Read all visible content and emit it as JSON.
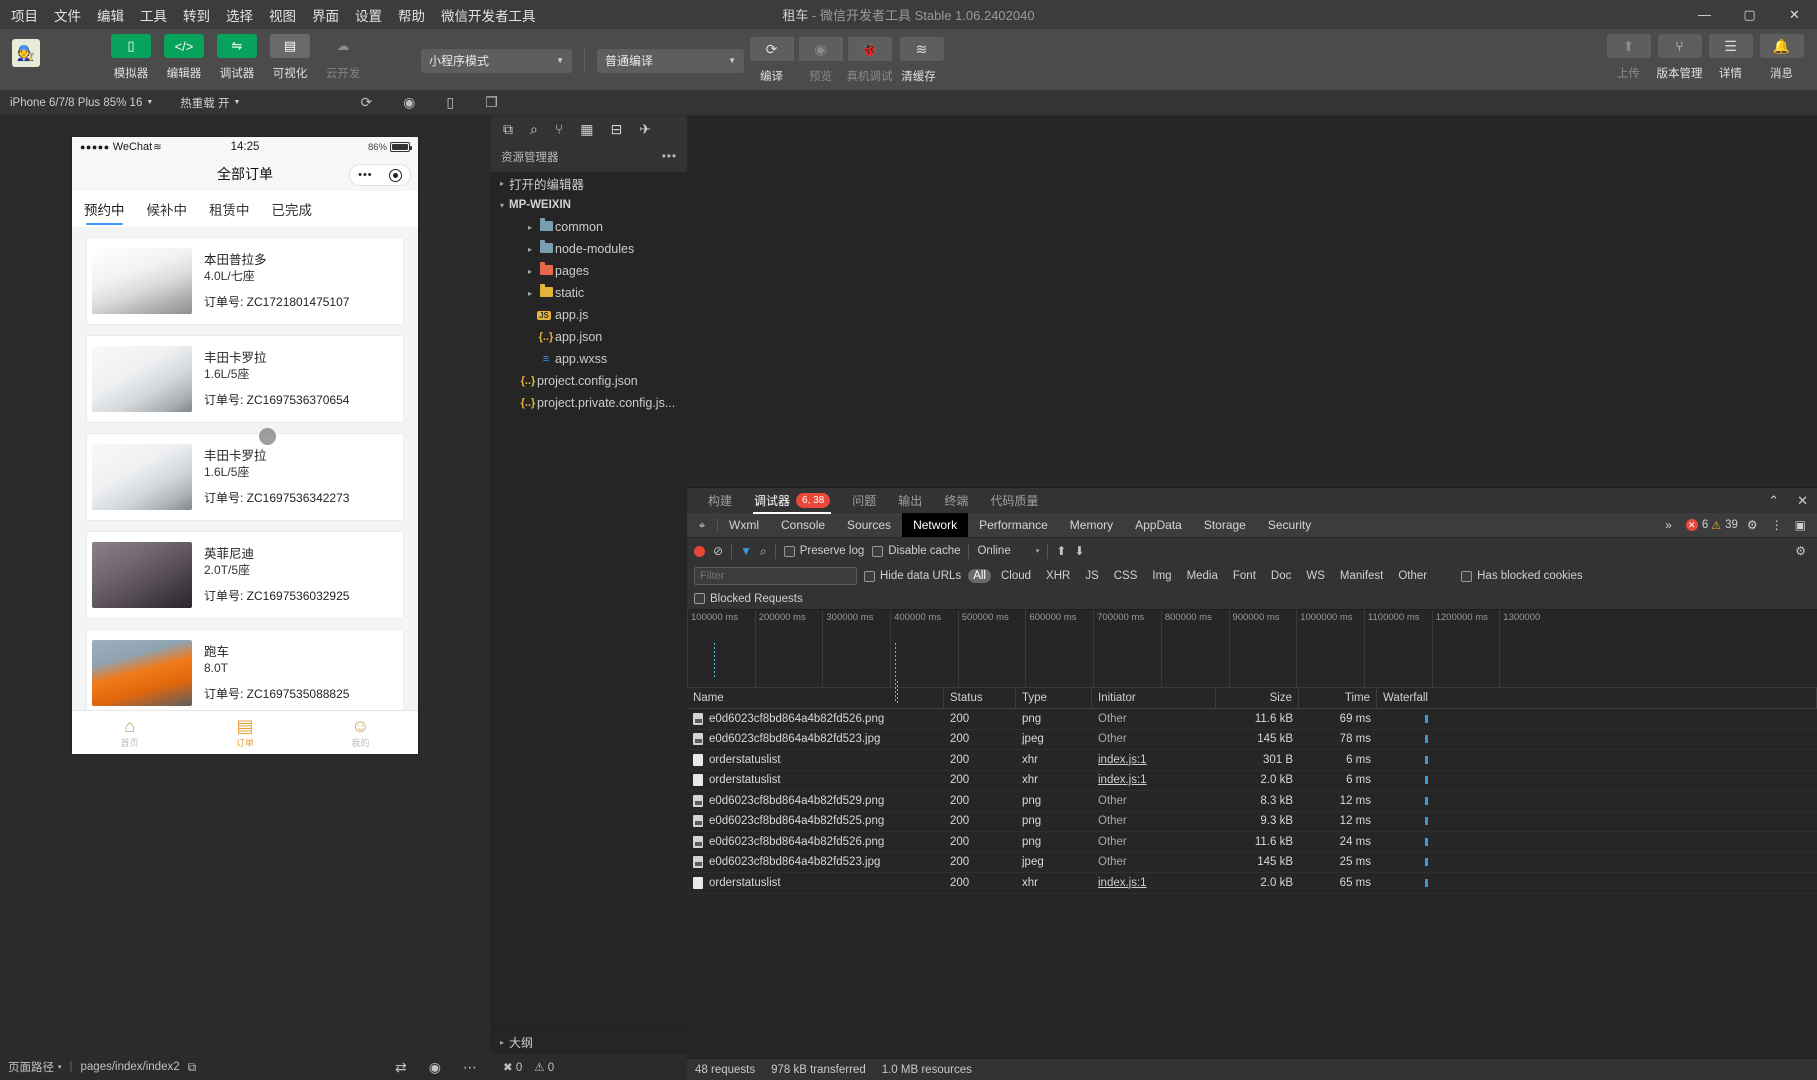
{
  "titlebar": {
    "menus": [
      "项目",
      "文件",
      "编辑",
      "工具",
      "转到",
      "选择",
      "视图",
      "界面",
      "设置",
      "帮助",
      "微信开发者工具"
    ],
    "title_main": "租车",
    "title_dim": " - 微信开发者工具 Stable 1.06.2402040",
    "minimize": "—",
    "maximize": "▢",
    "close": "✕"
  },
  "toolbar": {
    "avatar_icon": "user-avatar",
    "view_buttons": [
      {
        "label": "模拟器",
        "icon": "▯",
        "state": "green"
      },
      {
        "label": "编辑器",
        "icon": "</>",
        "state": "green"
      },
      {
        "label": "调试器",
        "icon": "⇋",
        "state": "green"
      },
      {
        "label": "可视化",
        "icon": "▤",
        "state": "gray"
      },
      {
        "label": "云开发",
        "icon": "☁",
        "state": "disabled"
      }
    ],
    "mode_select": "小程序模式",
    "compile_select": "普通编译",
    "action_buttons": [
      {
        "label": "编译",
        "icon": "⟳",
        "state": "normal"
      },
      {
        "label": "预览",
        "icon": "◉",
        "state": "disabled"
      },
      {
        "label": "真机调试",
        "icon": "🐞",
        "state": "disabled"
      },
      {
        "label": "清缓存",
        "icon": "≋",
        "state": "normal"
      }
    ],
    "right_buttons": [
      {
        "label": "上传",
        "icon": "⬆",
        "state": "disabled"
      },
      {
        "label": "版本管理",
        "icon": "⑂",
        "state": "normal"
      },
      {
        "label": "详情",
        "icon": "☰",
        "state": "normal"
      },
      {
        "label": "消息",
        "icon": "🔔",
        "state": "normal"
      }
    ]
  },
  "simbar": {
    "device": "iPhone 6/7/8 Plus 85% 16",
    "hotreload": "热重载 开",
    "icons": [
      "refresh-icon",
      "record-icon",
      "rotate-icon",
      "multi-window-icon"
    ]
  },
  "phone": {
    "status": {
      "dots": "●●●●●",
      "carrier": "WeChat",
      "wifi": "≋",
      "time": "14:25",
      "battery": "86%"
    },
    "nav_title": "全部订单",
    "capsule": {
      "dots": "•••",
      "circle": "◉"
    },
    "tabs": [
      {
        "label": "预约中",
        "active": true
      },
      {
        "label": "候补中",
        "active": false
      },
      {
        "label": "租赁中",
        "active": false
      },
      {
        "label": "已完成",
        "active": false
      }
    ],
    "order_label": "订单号:",
    "orders": [
      {
        "name": "本田普拉多",
        "spec": "4.0L/七座",
        "order_no": "ZC1721801475107",
        "car_kind": "white-suv"
      },
      {
        "name": "丰田卡罗拉",
        "spec": "1.6L/5座",
        "order_no": "ZC1697536370654",
        "car_kind": "white-sedan"
      },
      {
        "name": "丰田卡罗拉",
        "spec": "1.6L/5座",
        "order_no": "ZC1697536342273",
        "car_kind": "white-sedan"
      },
      {
        "name": "英菲尼迪",
        "spec": "2.0T/5座",
        "order_no": "ZC1697536032925",
        "car_kind": "dark-suv"
      },
      {
        "name": "跑车",
        "spec": "8.0T",
        "order_no": "ZC1697535088825",
        "car_kind": "orange-sport"
      }
    ],
    "tabbar": [
      {
        "label": "首页",
        "icon": "⌂",
        "active": false
      },
      {
        "label": "订单",
        "icon": "▤",
        "active": true
      },
      {
        "label": "我的",
        "icon": "☺",
        "active": false
      }
    ]
  },
  "pagepath": {
    "label": "页面路径",
    "caret": "▾",
    "path": "pages/index/index2",
    "copy_icon": "copy-icon",
    "right_icons": [
      "network-icon",
      "eye-icon",
      "more-icon"
    ]
  },
  "explorer": {
    "action_icons": [
      "files-icon",
      "search-icon",
      "source-control-icon",
      "extensions-icon",
      "debug-icon",
      "wechat-icon"
    ],
    "title": "资源管理器",
    "more": "•••",
    "tree": [
      {
        "label": "打开的编辑器",
        "level": 0,
        "arrow": "▸",
        "type": "section"
      },
      {
        "label": "MP-WEIXIN",
        "level": 0,
        "arrow": "▾",
        "type": "root"
      },
      {
        "label": "common",
        "level": 1,
        "arrow": "▸",
        "type": "folder",
        "color": "#7a9eb1"
      },
      {
        "label": "node-modules",
        "level": 1,
        "arrow": "▸",
        "type": "folder",
        "color": "#7a9eb1"
      },
      {
        "label": "pages",
        "level": 1,
        "arrow": "▸",
        "type": "folder",
        "color": "#e8684a"
      },
      {
        "label": "static",
        "level": 1,
        "arrow": "▸",
        "type": "folder",
        "color": "#e5b43a"
      },
      {
        "label": "app.js",
        "level": 1,
        "arrow": "",
        "type": "js",
        "icon": "JS",
        "color": "#e5b43a"
      },
      {
        "label": "app.json",
        "level": 1,
        "arrow": "",
        "type": "json",
        "icon": "{..}",
        "color": "#e5b43a"
      },
      {
        "label": "app.wxss",
        "level": 1,
        "arrow": "",
        "type": "css",
        "icon": "≡",
        "color": "#3b8ee0"
      },
      {
        "label": "project.config.json",
        "level": 0,
        "arrow": "",
        "type": "json",
        "icon": "{..}",
        "color": "#e5b43a"
      },
      {
        "label": "project.private.config.js...",
        "level": 0,
        "arrow": "",
        "type": "json",
        "icon": "{..}",
        "color": "#e5b43a"
      }
    ],
    "outline": {
      "label": "大纲",
      "arrow": "▸"
    },
    "status": {
      "errors": "0",
      "warnings": "0",
      "error_icon": "✖",
      "warn_icon": "⚠"
    }
  },
  "devtools": {
    "panel_tabs": [
      {
        "label": "构建",
        "active": false,
        "badge": ""
      },
      {
        "label": "调试器",
        "active": true,
        "badge": "6, 38"
      },
      {
        "label": "问题",
        "active": false,
        "badge": ""
      },
      {
        "label": "输出",
        "active": false,
        "badge": ""
      },
      {
        "label": "终端",
        "active": false,
        "badge": ""
      },
      {
        "label": "代码质量",
        "active": false,
        "badge": ""
      }
    ],
    "panel_controls": [
      "collapse-icon",
      "close-icon"
    ],
    "dev_tabs": [
      {
        "label": "Wxml",
        "selected": false
      },
      {
        "label": "Console",
        "selected": false
      },
      {
        "label": "Sources",
        "selected": false
      },
      {
        "label": "Network",
        "selected": true
      },
      {
        "label": "Performance",
        "selected": false
      },
      {
        "label": "Memory",
        "selected": false
      },
      {
        "label": "AppData",
        "selected": false
      },
      {
        "label": "Storage",
        "selected": false
      },
      {
        "label": "Security",
        "selected": false
      }
    ],
    "dev_overflow": "»",
    "error_count": "6",
    "warning_count": "39",
    "settings_icon": "⚙",
    "more_icon": "⋮",
    "dock_icon": "▣",
    "network": {
      "record_icon": "record-icon",
      "clear_icon": "⊘",
      "filter_icon": "▼",
      "search_icon": "⌕",
      "preserve_log": "Preserve log",
      "disable_cache": "Disable cache",
      "throttle": "Online",
      "throttle_caret": "▾",
      "import_icon": "⬆",
      "export_icon": "⬇",
      "settings_icon": "⚙",
      "filter_placeholder": "Filter",
      "filter_value": "",
      "hide_data_urls": "Hide data URLs",
      "types": [
        "All",
        "Cloud",
        "XHR",
        "JS",
        "CSS",
        "Img",
        "Media",
        "Font",
        "Doc",
        "WS",
        "Manifest",
        "Other"
      ],
      "selected_type": "All",
      "has_blocked_cookies": "Has blocked cookies",
      "blocked_requests": "Blocked Requests",
      "timeline_ticks": [
        "100000 ms",
        "200000 ms",
        "300000 ms",
        "400000 ms",
        "500000 ms",
        "600000 ms",
        "700000 ms",
        "800000 ms",
        "900000 ms",
        "1000000 ms",
        "1100000 ms",
        "1200000 ms",
        "1300000"
      ],
      "columns": [
        "Name",
        "Status",
        "Type",
        "Initiator",
        "Size",
        "Time",
        "Waterfall"
      ],
      "rows": [
        {
          "name": "e0d6023cf8bd864a4b82fd526.png",
          "status": "200",
          "type": "png",
          "initiator": "Other",
          "init_link": false,
          "size": "11.6 kB",
          "time": "69 ms",
          "icon": "image-icon",
          "wf": 48
        },
        {
          "name": "e0d6023cf8bd864a4b82fd523.jpg",
          "status": "200",
          "type": "jpeg",
          "initiator": "Other",
          "init_link": false,
          "size": "145 kB",
          "time": "78 ms",
          "icon": "image-icon",
          "wf": 48
        },
        {
          "name": "orderstatuslist",
          "status": "200",
          "type": "xhr",
          "initiator": "index.js:1",
          "init_link": true,
          "size": "301 B",
          "time": "6 ms",
          "icon": "doc-icon",
          "wf": 48
        },
        {
          "name": "orderstatuslist",
          "status": "200",
          "type": "xhr",
          "initiator": "index.js:1",
          "init_link": true,
          "size": "2.0 kB",
          "time": "6 ms",
          "icon": "doc-icon",
          "wf": 48
        },
        {
          "name": "e0d6023cf8bd864a4b82fd529.png",
          "status": "200",
          "type": "png",
          "initiator": "Other",
          "init_link": false,
          "size": "8.3 kB",
          "time": "12 ms",
          "icon": "image-icon",
          "wf": 48
        },
        {
          "name": "e0d6023cf8bd864a4b82fd525.png",
          "status": "200",
          "type": "png",
          "initiator": "Other",
          "init_link": false,
          "size": "9.3 kB",
          "time": "12 ms",
          "icon": "image-icon",
          "wf": 48
        },
        {
          "name": "e0d6023cf8bd864a4b82fd526.png",
          "status": "200",
          "type": "png",
          "initiator": "Other",
          "init_link": false,
          "size": "11.6 kB",
          "time": "24 ms",
          "icon": "image-icon",
          "wf": 48
        },
        {
          "name": "e0d6023cf8bd864a4b82fd523.jpg",
          "status": "200",
          "type": "jpeg",
          "initiator": "Other",
          "init_link": false,
          "size": "145 kB",
          "time": "25 ms",
          "icon": "image-icon",
          "wf": 48
        },
        {
          "name": "orderstatuslist",
          "status": "200",
          "type": "xhr",
          "initiator": "index.js:1",
          "init_link": true,
          "size": "2.0 kB",
          "time": "65 ms",
          "icon": "doc-icon",
          "wf": 48
        }
      ],
      "footer": {
        "requests": "48 requests",
        "transferred": "978 kB transferred",
        "resources": "1.0 MB resources"
      }
    }
  }
}
